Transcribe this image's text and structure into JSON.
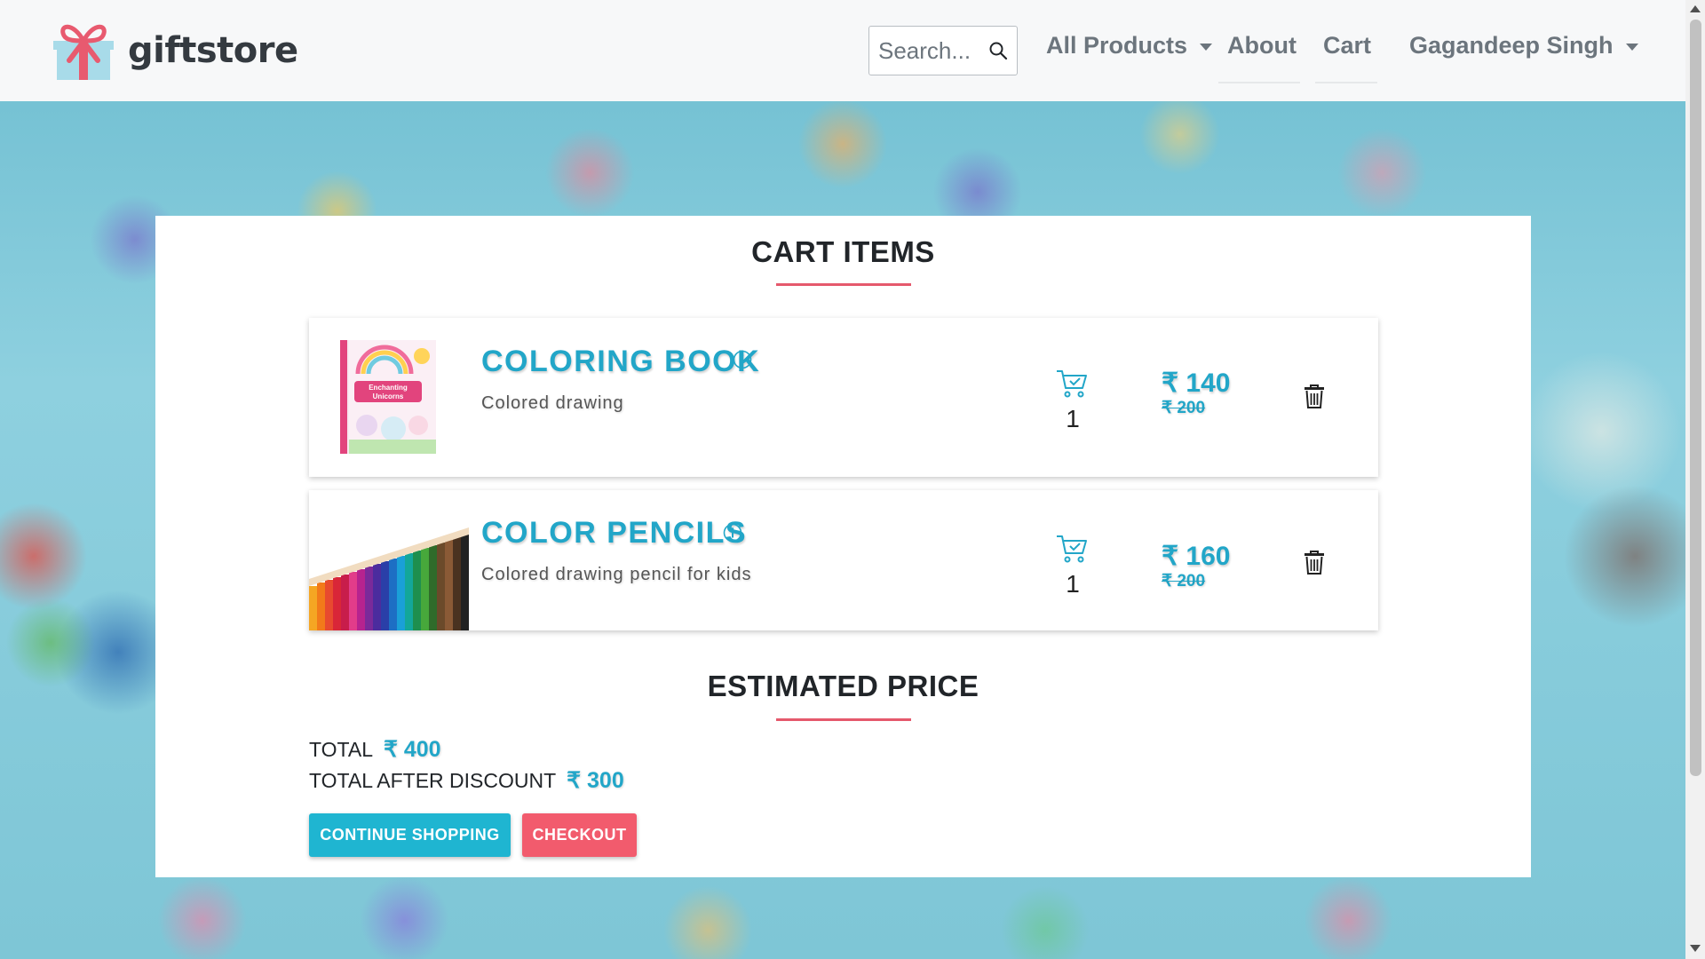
{
  "navbar": {
    "brand": "giftstore",
    "search_placeholder": "Search...",
    "links": {
      "all_products": "All Products",
      "about": "About",
      "cart": "Cart",
      "user": "Gagandeep Singh"
    }
  },
  "cart": {
    "title": "CART ITEMS",
    "items": [
      {
        "name": "COLORING BOOK",
        "description": "Colored drawing",
        "quantity": "1",
        "price": "₹ 140",
        "original_price": "₹ 200",
        "thumb_text": "Enchanting Unicorns"
      },
      {
        "name": "COLOR PENCILS",
        "description": "Colored drawing pencil for kids",
        "quantity": "1",
        "price": "₹ 160",
        "original_price": "₹ 200"
      }
    ]
  },
  "estimate": {
    "title": "ESTIMATED PRICE",
    "total_label": "TOTAL",
    "total_value": "₹ 400",
    "discount_label": "TOTAL AFTER DISCOUNT",
    "discount_value": "₹ 300"
  },
  "buttons": {
    "continue_shopping": "CONTINUE SHOPPING",
    "checkout": "CHECKOUT"
  },
  "colors": {
    "accent": "#22a6c8",
    "danger": "#f25b6d",
    "title_underline": "#e5596c"
  }
}
